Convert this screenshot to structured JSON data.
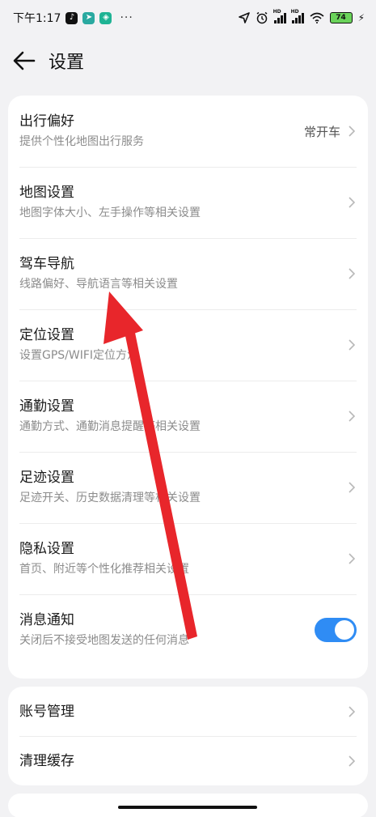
{
  "status_bar": {
    "time": "下午1:17",
    "dots": "···",
    "battery": "74"
  },
  "header": {
    "title": "设置"
  },
  "settings_group1": [
    {
      "title": "出行偏好",
      "desc": "提供个性化地图出行服务",
      "value": "常开车"
    },
    {
      "title": "地图设置",
      "desc": "地图字体大小、左手操作等相关设置"
    },
    {
      "title": "驾车导航",
      "desc": "线路偏好、导航语言等相关设置"
    },
    {
      "title": "定位设置",
      "desc": "设置GPS/WIFI定位方法"
    },
    {
      "title": "通勤设置",
      "desc": "通勤方式、通勤消息提醒等相关设置"
    },
    {
      "title": "足迹设置",
      "desc": "足迹开关、历史数据清理等相关设置"
    },
    {
      "title": "隐私设置",
      "desc": "首页、附近等个性化推荐相关设置"
    },
    {
      "title": "消息通知",
      "desc": "关闭后不接受地图发送的任何消息",
      "toggle": true
    }
  ],
  "settings_group2": [
    {
      "title": "账号管理"
    },
    {
      "title": "清理缓存"
    }
  ],
  "colors": {
    "background": "#f2f2f4",
    "card": "#ffffff",
    "toggle_on": "#2f8cf4",
    "annotation_arrow": "#e8262b",
    "battery": "#6ad35a"
  },
  "icons": {
    "back": "back-arrow-icon",
    "chevron": "chevron-right-icon"
  }
}
